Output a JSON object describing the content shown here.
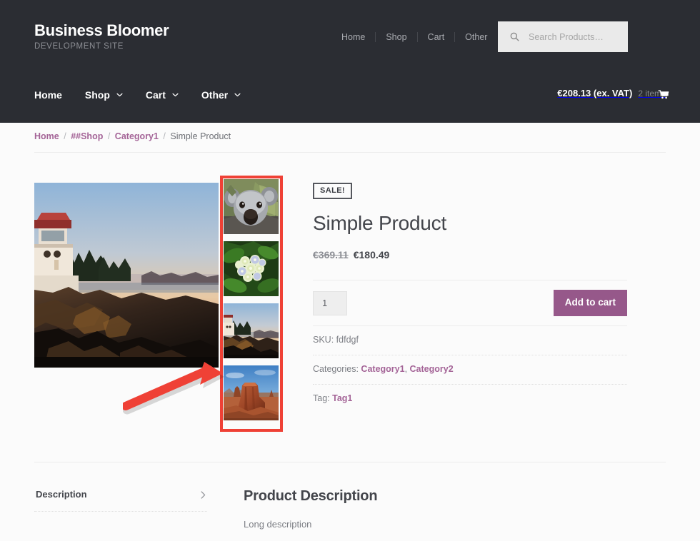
{
  "header": {
    "brand_title": "Business Bloomer",
    "brand_subtitle": "DEVELOPMENT SITE",
    "top_nav": [
      {
        "label": "Home"
      },
      {
        "label": "Shop"
      },
      {
        "label": "Cart"
      },
      {
        "label": "Other"
      }
    ],
    "search": {
      "placeholder": "Search Products…",
      "value": "",
      "icon": "search-icon"
    },
    "main_nav": [
      {
        "label": "Home",
        "has_dropdown": false
      },
      {
        "label": "Shop",
        "has_dropdown": true
      },
      {
        "label": "Cart",
        "has_dropdown": true
      },
      {
        "label": "Other",
        "has_dropdown": true
      }
    ],
    "cart": {
      "total": "€208.13 (ex. VAT)",
      "count": "2 items",
      "icon": "shopping-cart-icon"
    },
    "background_color": "#2b2d33"
  },
  "breadcrumb": {
    "items": [
      {
        "label": "Home",
        "is_link": true
      },
      {
        "label": "##Shop",
        "is_link": true
      },
      {
        "label": "Category1",
        "is_link": true
      },
      {
        "label": "Simple Product",
        "is_link": false
      }
    ],
    "separator": "/"
  },
  "gallery": {
    "main_image_alt": "lighthouse-on-rocky-coast-at-sunset",
    "thumbnails": [
      {
        "alt": "koala-bear-photo"
      },
      {
        "alt": "hydrangea-flower-photo"
      },
      {
        "alt": "lighthouse-coast-sunset-photo"
      },
      {
        "alt": "desert-mesa-rock-photo"
      }
    ],
    "annotation": {
      "highlight_color": "#ef4136",
      "arrow_color": "#ef4136",
      "target": "product-image-thumbnails"
    }
  },
  "product": {
    "sale_badge": "SALE!",
    "title": "Simple Product",
    "price_old": "€369.11",
    "price_new": "€180.49",
    "quantity": "1",
    "add_to_cart_label": "Add to cart",
    "accent_color": "#96588a",
    "meta": [
      {
        "label": "SKU:",
        "values": [
          {
            "text": "fdfdgf",
            "is_link": false
          }
        ]
      },
      {
        "label": "Categories:",
        "values": [
          {
            "text": "Category1",
            "is_link": true
          },
          {
            "text": "Category2",
            "is_link": true
          }
        ]
      },
      {
        "label": "Tag:",
        "values": [
          {
            "text": "Tag1",
            "is_link": true
          }
        ]
      }
    ]
  },
  "tabs": {
    "items": [
      {
        "label": "Description",
        "chevron": "chevron-right-icon"
      }
    ]
  },
  "description": {
    "heading": "Product Description",
    "body": "Long description"
  }
}
